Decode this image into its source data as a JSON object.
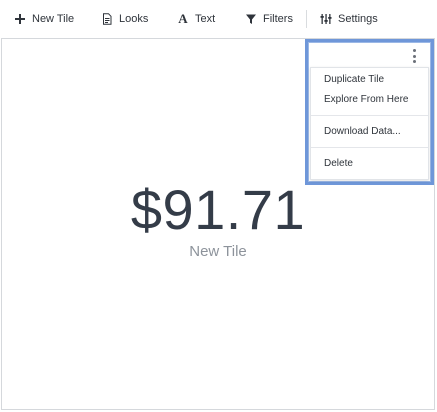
{
  "toolbar": {
    "new_tile": {
      "label": "New Tile",
      "icon": "plus-icon"
    },
    "looks": {
      "label": "Looks",
      "icon": "document-icon"
    },
    "text": {
      "label": "Text",
      "icon": "text-a-icon"
    },
    "filters": {
      "label": "Filters",
      "icon": "funnel-icon"
    },
    "settings": {
      "label": "Settings",
      "icon": "sliders-icon"
    }
  },
  "tile": {
    "value": "$91.71",
    "title": "New Tile"
  },
  "tile_menu": {
    "icon": "kebab-menu-icon",
    "items": [
      {
        "label": "Duplicate Tile"
      },
      {
        "label": "Explore From Here"
      },
      {
        "label": "Download Data..."
      },
      {
        "label": "Delete"
      }
    ]
  },
  "colors": {
    "highlight_border": "#6f97d9",
    "value_text": "#343c48",
    "title_text": "#8d939b"
  }
}
